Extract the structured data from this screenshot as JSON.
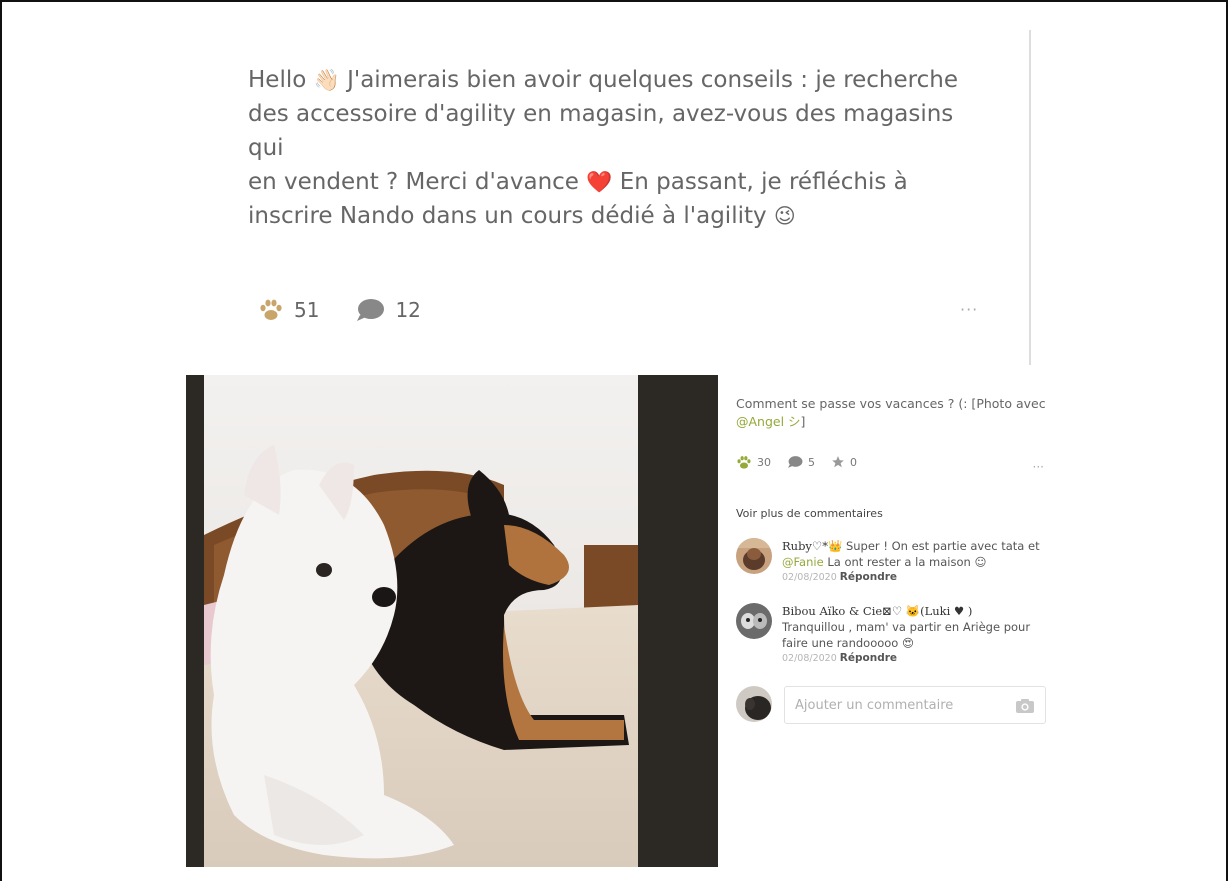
{
  "post": {
    "line1": "Hello",
    "line1_rest": "J'aimerais bien avoir quelques conseils : je recherche",
    "line2": "des accessoire d'agility en magasin, avez-vous des magasins qui",
    "line3a": "en vendent ? Merci d'avance",
    "line3b": "En passant, je réfléchis à",
    "line4": "inscrire Nando dans un cours dédié à l'agility",
    "emoji_wave": "👋🏻",
    "emoji_heart": "❤️",
    "emoji_wink": "😉",
    "paw_count": "51",
    "comment_count": "12",
    "more": "···"
  },
  "card": {
    "caption_text": "Comment se passe vos vacances ? (: [Photo avec",
    "caption_mention": "@Angel シ",
    "caption_end": "]",
    "paw_count": "30",
    "comment_count": "5",
    "star_count": "0",
    "more": "···",
    "see_more": "Voir plus de commentaires"
  },
  "comments": [
    {
      "author": "Ruby♡*👑",
      "text_a": "Super ! On est partie avec tata",
      "text_b": "et",
      "mention": "@Fanie",
      "text_c": "La ont rester a la maison ☺",
      "date": "02/08/2020",
      "reply": "Répondre"
    },
    {
      "author": "Bibou Aïko & Cie⊠♡ 🐱(Luki ♥ )",
      "text": "Tranquillou , mam' va partir en Ariège pour faire une randooooo 😍",
      "date": "02/08/2020",
      "reply": "Répondre"
    }
  ],
  "new_comment": {
    "placeholder": "Ajouter un commentaire"
  },
  "colors": {
    "paw": "#c9a56a",
    "mention": "#94a93a",
    "paw_green": "#94a93a",
    "dark_panel": "#2c2924"
  }
}
